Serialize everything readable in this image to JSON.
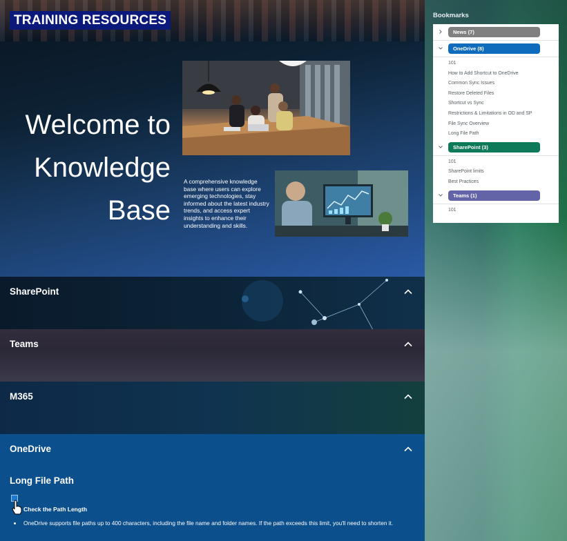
{
  "hero": {
    "badge": "TRAINING RESOURCES",
    "welcome_lines": [
      "Welcome to",
      "Knowledge",
      "Base"
    ],
    "description": "A comprehensive knowledge base where users can explore emerging technologies, stay informed about the latest industry trends, and access expert insights to enhance their understanding and skills."
  },
  "sections": [
    {
      "label": "SharePoint",
      "icon": "chevron-up-icon"
    },
    {
      "label": "Teams",
      "icon": "chevron-up-icon"
    },
    {
      "label": "M365",
      "icon": "chevron-up-icon"
    },
    {
      "label": "OneDrive",
      "icon": "chevron-up-icon"
    }
  ],
  "onedrive": {
    "subtitle": "Long File Path",
    "step": "Check the Path Length",
    "bullet": "OneDrive supports file paths up to 400 characters, including the file name and folder names. If the path exceeds this limit, you'll need to shorten it."
  },
  "bookmarks": {
    "heading": "Bookmarks",
    "groups": [
      {
        "label": "News (7)",
        "color": "#808080",
        "expanded": false,
        "items": []
      },
      {
        "label": "OneDrive (8)",
        "color": "#0f6cbd",
        "expanded": true,
        "items": [
          "101",
          "How to Add Shortcut to OneDrive",
          "Common Sync Issues",
          "Restore Deleted Files",
          "Shortcut vs Sync",
          "Restrictions & Limitations in OD and SP",
          "File Sync Overview",
          "Long File Path"
        ]
      },
      {
        "label": "SharePoint (3)",
        "color": "#0e7a5a",
        "expanded": true,
        "items": [
          "101",
          "SharePoint limits",
          "Best Practices"
        ]
      },
      {
        "label": "Teams (1)",
        "color": "#6264a7",
        "expanded": true,
        "items": [
          "101"
        ]
      }
    ]
  },
  "colors": {
    "badge_bg": "#0b1a7a",
    "onedrive_section": "#0b4f8c"
  }
}
